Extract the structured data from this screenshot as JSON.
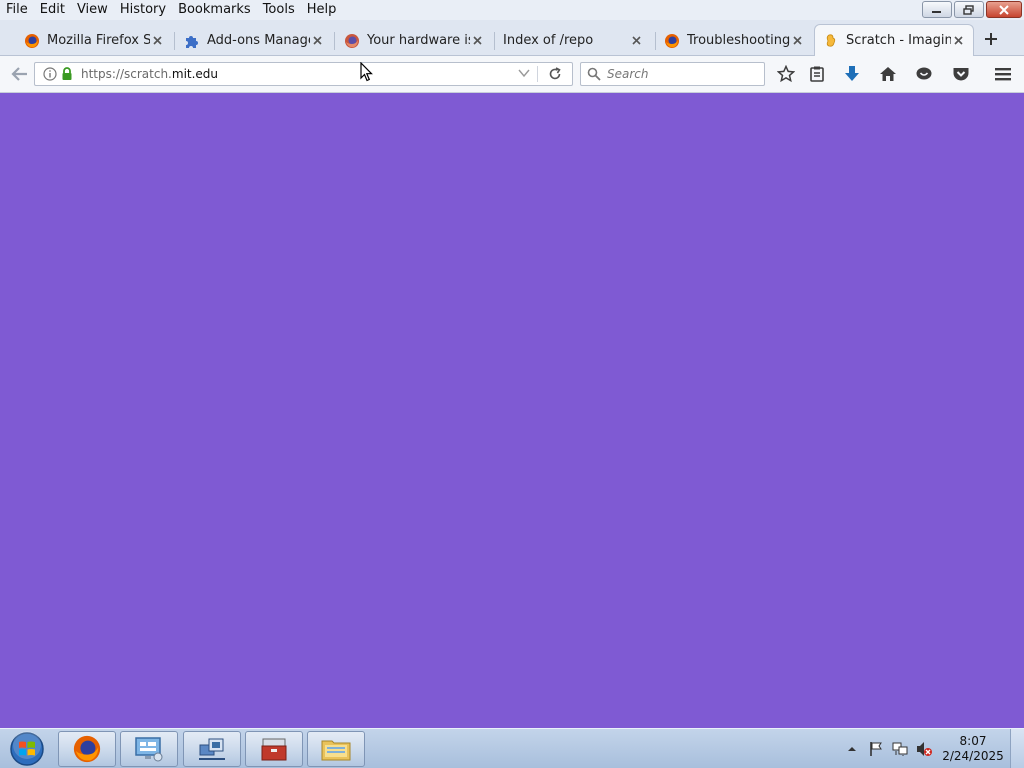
{
  "menu": {
    "items": [
      "File",
      "Edit",
      "View",
      "History",
      "Bookmarks",
      "Tools",
      "Help"
    ]
  },
  "tabs": [
    {
      "label": "Mozilla Firefox St...",
      "icon": "firefox-icon"
    },
    {
      "label": "Add-ons Manager",
      "icon": "puzzle-piece-icon"
    },
    {
      "label": "Your hardware is ...",
      "icon": "firefox-icon"
    },
    {
      "label": "Index of /repo",
      "icon": "none"
    },
    {
      "label": "Troubleshooting ...",
      "icon": "firefox-icon"
    },
    {
      "label": "Scratch - Imagin...",
      "icon": "scratch-icon",
      "active": true
    }
  ],
  "navbar": {
    "url_scheme": "https://scratch.",
    "url_host": "mit.edu",
    "search_placeholder": "Search"
  },
  "taskbar": {
    "apps": [
      "firefox",
      "remote-desktop",
      "network",
      "toolbox",
      "file-explorer"
    ],
    "clock_time": "8:07",
    "clock_date": "2/24/2025"
  },
  "colors": {
    "page_background": "#7f5ad3",
    "accent": "#0a84ff"
  }
}
